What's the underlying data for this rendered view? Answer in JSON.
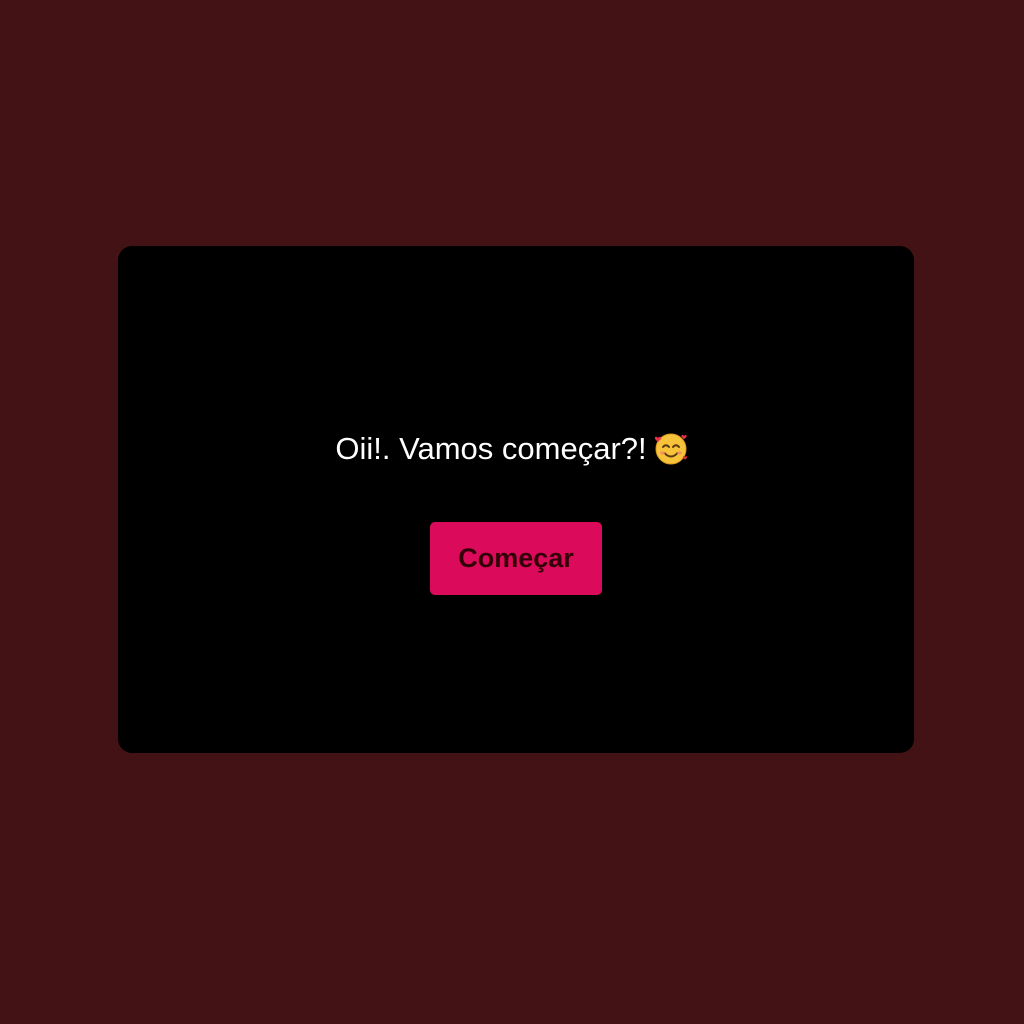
{
  "greeting": {
    "text": "Oii!. Vamos começar?!",
    "emoji_icon": "smiling-face-with-hearts-icon"
  },
  "start_button": {
    "label": "Começar"
  },
  "colors": {
    "page_background": "#421214",
    "card_background": "#000000",
    "button_background": "#dc0a5a",
    "button_text": "#330008",
    "greeting_text": "#ffffff"
  }
}
